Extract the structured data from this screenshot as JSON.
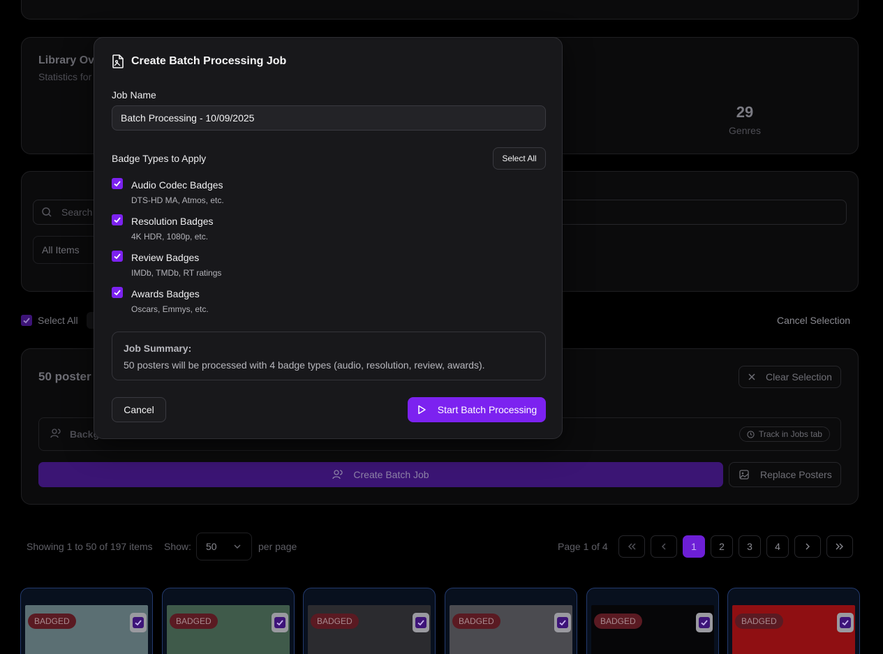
{
  "background": {
    "library": {
      "title": "Library Ov",
      "subtitle": "Statistics for",
      "genres_value": "29",
      "genres_label": "Genres"
    },
    "search": {
      "placeholder": "Search"
    },
    "filter": {
      "value": "All Items"
    },
    "selection": {
      "select_all": "Select All",
      "cancel_selection": "Cancel Selection"
    },
    "batch": {
      "posters_selected": "50 poster",
      "clear_selection": "Clear Selection",
      "info_label": "Backg",
      "track_jobs": "Track in Jobs tab",
      "create_batch_job": "Create Batch Job",
      "replace_posters": "Replace Posters"
    },
    "pagination": {
      "showing": "Showing 1 to 50 of 197 items",
      "show_label": "Show:",
      "page_size": "50",
      "per_page": "per page",
      "page_of": "Page 1 of 4",
      "pages": [
        "1",
        "2",
        "3",
        "4"
      ]
    },
    "posters": [
      {
        "badge": "BADGED",
        "color": "#5b6f73"
      },
      {
        "badge": "BADGED",
        "color": "#3f5a4a"
      },
      {
        "badge": "BADGED",
        "color": "#2b2b2f"
      },
      {
        "badge": "BADGED",
        "color": "#4b4b50"
      },
      {
        "badge": "BADGED",
        "color": "#060608"
      },
      {
        "badge": "BADGED",
        "color": "#8f0f12"
      }
    ]
  },
  "modal": {
    "title": "Create Batch Processing Job",
    "job_name_label": "Job Name",
    "job_name_value": "Batch Processing - 10/09/2025",
    "badge_types_label": "Badge Types to Apply",
    "select_all": "Select All",
    "options": [
      {
        "name": "Audio Codec Badges",
        "desc": "DTS-HD MA, Atmos, etc.",
        "checked": true
      },
      {
        "name": "Resolution Badges",
        "desc": "4K HDR, 1080p, etc.",
        "checked": true
      },
      {
        "name": "Review Badges",
        "desc": "IMDb, TMDb, RT ratings",
        "checked": true
      },
      {
        "name": "Awards Badges",
        "desc": "Oscars, Emmys, etc.",
        "checked": true
      }
    ],
    "summary": {
      "title": "Job Summary:",
      "text": "50 posters will be processed with 4 badge types (audio, resolution, review, awards)."
    },
    "cancel": "Cancel",
    "start": "Start Batch Processing"
  },
  "colors": {
    "accent": "#7c22f0",
    "background": "#000000",
    "modal": "#18181b"
  }
}
